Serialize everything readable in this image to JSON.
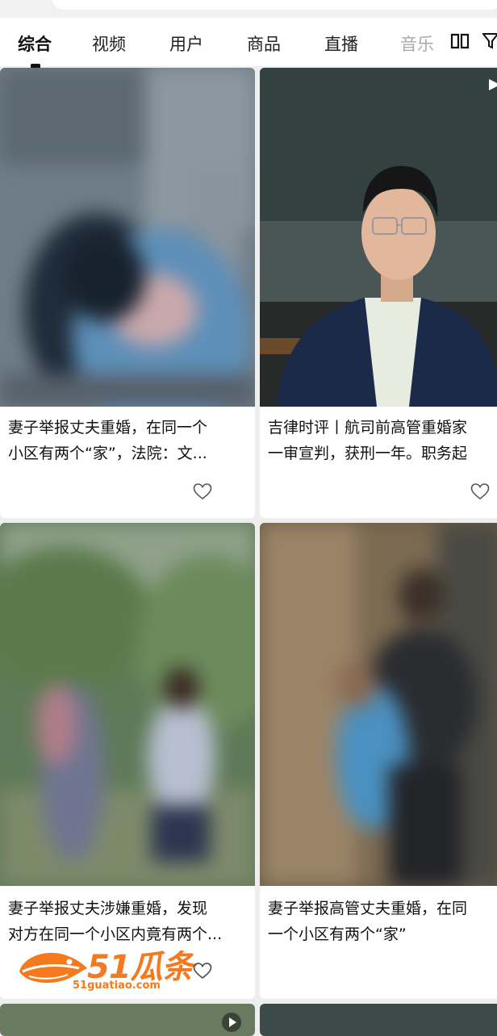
{
  "tabs": [
    {
      "label": "综合",
      "active": true
    },
    {
      "label": "视频",
      "active": false
    },
    {
      "label": "用户",
      "active": false
    },
    {
      "label": "商品",
      "active": false
    },
    {
      "label": "直播",
      "active": false
    },
    {
      "label": "音乐",
      "active": false
    }
  ],
  "icons": {
    "layout": "book-open-icon",
    "filter": "filter-icon",
    "like": "heart-icon",
    "play": "play-icon"
  },
  "cards": [
    {
      "line1": "妻子举报丈夫重婚，在同一个",
      "line2": "小区有两个“家”，法院：文..."
    },
    {
      "line1": "吉律时评丨航司前高管重婚家",
      "line2": "一审宣判，获刑一年。职务起"
    },
    {
      "line1": "妻子举报丈夫涉嫌重婚，发现",
      "line2": "对方在同一个小区内竟有两个..."
    },
    {
      "line1": "妻子举报高管丈夫重婚，在同",
      "line2": "一个小区有两个“家”"
    }
  ],
  "watermark": {
    "brand": "51瓜条",
    "url": "51guatiao.com",
    "color": "#f47a1f"
  }
}
